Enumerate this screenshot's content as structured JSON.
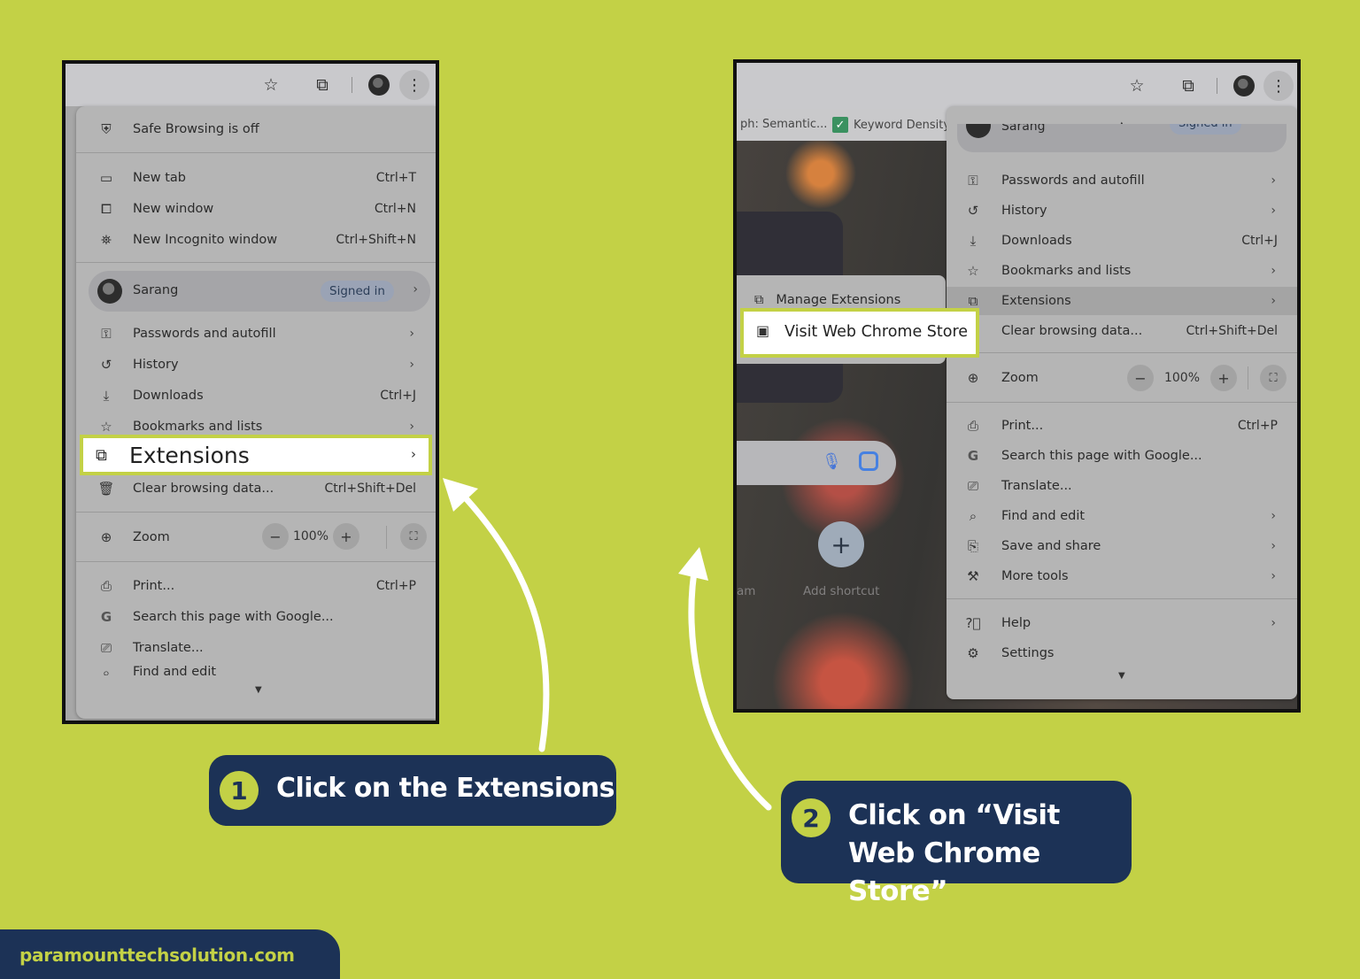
{
  "panel1": {
    "menu": {
      "safe_browsing": "Safe Browsing is off",
      "new_tab": {
        "label": "New tab",
        "shortcut": "Ctrl+T"
      },
      "new_window": {
        "label": "New window",
        "shortcut": "Ctrl+N"
      },
      "new_incognito": {
        "label": "New Incognito window",
        "shortcut": "Ctrl+Shift+N"
      },
      "profile": {
        "name": "Sarang",
        "status": "Signed in"
      },
      "passwords": {
        "label": "Passwords and autofill"
      },
      "history": {
        "label": "History"
      },
      "downloads": {
        "label": "Downloads",
        "shortcut": "Ctrl+J"
      },
      "bookmarks": {
        "label": "Bookmarks and lists"
      },
      "extensions": {
        "label": "Extensions"
      },
      "clear_data": {
        "label": "Clear browsing data...",
        "shortcut": "Ctrl+Shift+Del"
      },
      "zoom": {
        "label": "Zoom",
        "value": "100%",
        "minus": "−",
        "plus": "+"
      },
      "print": {
        "label": "Print...",
        "shortcut": "Ctrl+P"
      },
      "search_page": {
        "label": "Search this page with Google..."
      },
      "translate": {
        "label": "Translate..."
      },
      "find_edit_partial": "Find and edit"
    }
  },
  "panel2": {
    "bookmarks_bar": {
      "item1": "ph: Semantic...",
      "item2": "Keyword Density"
    },
    "ntp": {
      "add_shortcut": "Add shortcut",
      "partial_label": "am"
    },
    "submenu": {
      "manage_extensions": "Manage Extensions",
      "visit_store": "Visit Web Chrome Store"
    },
    "menu": {
      "profile": {
        "name": "Sarang",
        "status": "Signed in"
      },
      "passwords": {
        "label": "Passwords and autofill"
      },
      "history": {
        "label": "History"
      },
      "downloads": {
        "label": "Downloads",
        "shortcut": "Ctrl+J"
      },
      "bookmarks": {
        "label": "Bookmarks and lists"
      },
      "extensions": {
        "label": "Extensions"
      },
      "clear_data": {
        "label": "Clear browsing data...",
        "shortcut": "Ctrl+Shift+Del"
      },
      "zoom": {
        "label": "Zoom",
        "value": "100%",
        "minus": "−",
        "plus": "+"
      },
      "print": {
        "label": "Print...",
        "shortcut": "Ctrl+P"
      },
      "search_page": {
        "label": "Search this page with Google..."
      },
      "translate": {
        "label": "Translate..."
      },
      "find_edit": {
        "label": "Find and edit"
      },
      "save_share": {
        "label": "Save and share"
      },
      "more_tools": {
        "label": "More tools"
      },
      "help": {
        "label": "Help"
      },
      "settings": {
        "label": "Settings"
      }
    }
  },
  "captions": {
    "step1": {
      "number": "1",
      "text": "Click on the Extensions"
    },
    "step2": {
      "number": "2",
      "text": "Click on “Visit Web Chrome Store”"
    }
  },
  "brand": "paramounttechsolution.com",
  "colors": {
    "background": "#c3d146",
    "caption_bg": "#1c3256",
    "highlight_border": "#c3d146"
  },
  "icons": [
    "star-icon",
    "extension-puzzle-icon",
    "avatar",
    "more-vert-icon",
    "shield-icon",
    "new-tab-icon",
    "new-window-icon",
    "incognito-icon",
    "key-icon",
    "history-icon",
    "download-icon",
    "bookmark-star-icon",
    "trash-icon",
    "zoom-icon",
    "fullscreen-icon",
    "print-icon",
    "google-g-icon",
    "translate-icon",
    "find-icon",
    "save-icon",
    "toolbox-icon",
    "help-icon",
    "settings-gear-icon",
    "store-icon",
    "mic-icon",
    "lens-icon",
    "plus-icon",
    "check-icon"
  ]
}
